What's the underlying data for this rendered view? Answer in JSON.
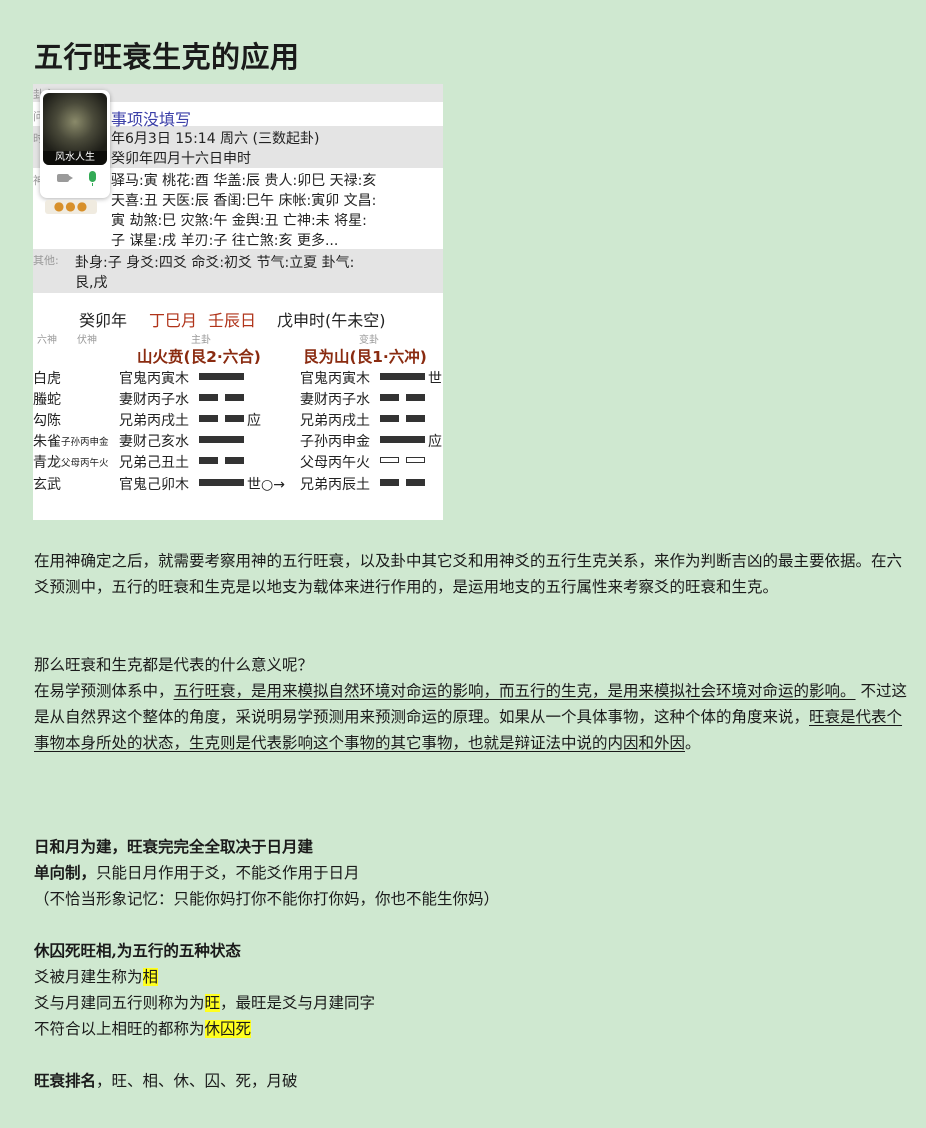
{
  "title": "五行旺衰生克的应用",
  "screenshot": {
    "side_labels": [
      "卦主",
      "问事",
      "时间",
      "神煞",
      "其他:"
    ],
    "avatar_caption": "风水人生",
    "more_icon": "more-dots-icon",
    "question": "事项没填写",
    "time_line": "年6月3日 15:14 周六 (三数起卦)",
    "lunar_line": "癸卯年四月十六日申时",
    "shensha": [
      "驿马:寅   桃花:酉   华盖:辰   贵人:卯巳   天禄:亥",
      "天喜:丑   天医:辰   香闺:巳午   床帐:寅卯   文昌:",
      "寅   劫煞:巳   灾煞:午   金舆:丑   亡神:未   将星:",
      "子   谋星:戌   羊刃:子   往亡煞:亥   更多..."
    ],
    "other_line1": "卦身:子    身爻:四爻    命爻:初爻    节气:立夏    卦气:",
    "other_line2": "艮,戌",
    "gz_year": "癸卯年",
    "gz_month": "丁巳月",
    "gz_day": "壬辰日",
    "gz_hour": "戊申时(午未空)",
    "col_liushen": "六神",
    "col_fushen": "伏神",
    "col_zhugua": "主卦",
    "col_biangua": "变卦",
    "main_name": "山火贲(艮2·六合)",
    "change_name": "艮为山(艮1·六冲)",
    "liushen": [
      "白虎",
      "螣蛇",
      "勾陈",
      "朱雀",
      "青龙",
      "玄武"
    ],
    "fushen": [
      "",
      "",
      "",
      "子孙丙申金",
      "父母丙午火",
      ""
    ],
    "main_lines": [
      "官鬼丙寅木",
      "妻财丙子水",
      "兄弟丙戌土",
      "妻财己亥水",
      "兄弟己丑土",
      "官鬼己卯木"
    ],
    "main_marks": [
      "",
      "",
      "应",
      "",
      "",
      "世○→"
    ],
    "change_lines": [
      "官鬼丙寅木",
      "妻财丙子水",
      "兄弟丙戌土",
      "子孙丙申金",
      "父母丙午火",
      "兄弟丙辰土"
    ],
    "change_marks": [
      "世",
      "",
      "",
      "应",
      "",
      ""
    ]
  },
  "p1": "在用神确定之后，就需要考察用神的五行旺衰，以及卦中其它爻和用神爻的五行生克关系，来作为判断吉凶的最主要依据。在六爻预测中，五行的旺衰和生克是以地支为载体来进行作用的，是运用地支的五行属性来考察爻的旺衰和生克。",
  "p2_q": "那么旺衰和生克都是代表的什么意义呢？",
  "p2_a1": "在易学预测体系中，",
  "p2_u1": "五行旺衰，是用来模拟自然环境对命运的影响，而五行的生克，是用来模拟社会环境对命运的影响。",
  "p2_a2": " 不过这是从自然界这个整体的角度，采说明易学预测用来预测命运的原理。如果从一个具体事物，这种个体的角度来说，",
  "p2_u2": "旺衰是代表个事物本身所处的状态，生克则是代表影响这个事物的其它事物，也就是辩证法中说的内因和外因",
  "p2_end": "。",
  "s1_head": "日和月为建，旺衰完完全全取决于日月建",
  "s1_b": "单向制，",
  "s1_t": "只能日月作用于爻，不能爻作用于日月",
  "s1_note": "（不恰当形象记忆：只能你妈打你不能你打你妈，你也不能生你妈）",
  "s2_head": "休囚死旺相,为五行的五种状态",
  "s2_l1": "爻被月建生称为",
  "s2_h1": "相",
  "s2_l2": "爻与月建同五行则称为为",
  "s2_h2": "旺",
  "s2_l2b": "，最旺是爻与月建同字",
  "s2_l3": "不符合以上相旺的都称为",
  "s2_h3": "休囚死",
  "s3_b": "旺衰排名",
  "s3_t": "，旺、相、休、囚、死，月破"
}
